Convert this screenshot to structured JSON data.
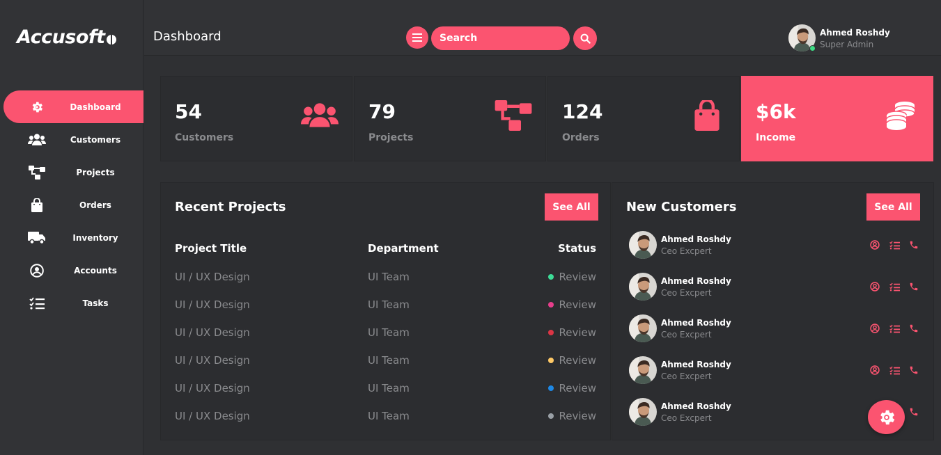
{
  "brand": {
    "logo_text": "Accusoft",
    "accent_color": "#fb5470"
  },
  "sidebar": {
    "items": [
      {
        "label": "Dashboard",
        "icon": "gear-icon",
        "active": true
      },
      {
        "label": "Customers",
        "icon": "users-icon",
        "active": false
      },
      {
        "label": "Projects",
        "icon": "project-tree-icon",
        "active": false
      },
      {
        "label": "Orders",
        "icon": "shopping-bag-icon",
        "active": false
      },
      {
        "label": "Inventory",
        "icon": "truck-icon",
        "active": false
      },
      {
        "label": "Accounts",
        "icon": "user-circle-icon",
        "active": false
      },
      {
        "label": "Tasks",
        "icon": "checklist-icon",
        "active": false
      }
    ]
  },
  "header": {
    "title": "Dashboard",
    "search_placeholder": "Search",
    "user": {
      "name": "Ahmed Roshdy",
      "role": "Super Admin",
      "status": "online"
    }
  },
  "stats": [
    {
      "value": "54",
      "label": "Customers",
      "icon": "users-icon"
    },
    {
      "value": "79",
      "label": "Projects",
      "icon": "project-tree-icon"
    },
    {
      "value": "124",
      "label": "Orders",
      "icon": "shopping-bag-icon"
    },
    {
      "value": "$6k",
      "label": "Income",
      "icon": "coins-icon",
      "highlighted": true
    }
  ],
  "recent_projects": {
    "title": "Recent Projects",
    "see_all_label": "See All",
    "columns": [
      "Project Title",
      "Department",
      "Status"
    ],
    "rows": [
      {
        "title": "UI / UX Design",
        "department": "UI Team",
        "status": "Review",
        "status_color": "#3ddc97"
      },
      {
        "title": "UI / UX Design",
        "department": "UI Team",
        "status": "Review",
        "status_color": "#e83e8c"
      },
      {
        "title": "UI / UX Design",
        "department": "UI Team",
        "status": "Review",
        "status_color": "#dc3545"
      },
      {
        "title": "UI / UX Design",
        "department": "UI Team",
        "status": "Review",
        "status_color": "#ffc966"
      },
      {
        "title": "UI / UX Design",
        "department": "UI Team",
        "status": "Review",
        "status_color": "#1e88e5"
      },
      {
        "title": "UI / UX Design",
        "department": "UI Team",
        "status": "Review",
        "status_color": "#9aa0a6"
      }
    ]
  },
  "new_customers": {
    "title": "New Customers",
    "see_all_label": "See All",
    "rows": [
      {
        "name": "Ahmed Roshdy",
        "role": "Ceo Excpert"
      },
      {
        "name": "Ahmed Roshdy",
        "role": "Ceo Excpert"
      },
      {
        "name": "Ahmed Roshdy",
        "role": "Ceo Excpert"
      },
      {
        "name": "Ahmed Roshdy",
        "role": "Ceo Excpert"
      },
      {
        "name": "Ahmed Roshdy",
        "role": "Ceo Excpert"
      }
    ],
    "row_actions": [
      "user-circle-icon",
      "list-icon",
      "phone-icon"
    ]
  }
}
